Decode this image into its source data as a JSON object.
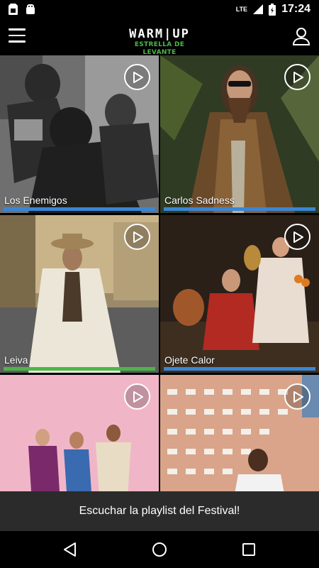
{
  "status_bar": {
    "time": "17:24",
    "network": "LTE"
  },
  "app_bar": {
    "logo_top": "WARM|UP",
    "logo_bottom": "ESTRELLA DE LEVANTE"
  },
  "artists": [
    {
      "name": "Los Enemigos",
      "bar_color": "#3a86d6"
    },
    {
      "name": "Carlos Sadness",
      "bar_color": "#3a86d6"
    },
    {
      "name": "Leiva",
      "bar_color": "#4cb648"
    },
    {
      "name": "Ojete Calor",
      "bar_color": "#3a86d6"
    },
    {
      "name": "",
      "bar_color": ""
    },
    {
      "name": "",
      "bar_color": ""
    }
  ],
  "playlist_banner": {
    "label": "Escuchar la playlist del Festival!"
  },
  "colors": {
    "accent_green": "#4cb648",
    "accent_blue": "#3a86d6",
    "banner_bg": "#2b2b2b"
  },
  "icons": [
    "sim-card-icon",
    "android-icon",
    "signal-icon",
    "battery-icon",
    "menu-icon",
    "user-icon",
    "play-icon",
    "back-icon",
    "home-icon",
    "recents-icon"
  ]
}
